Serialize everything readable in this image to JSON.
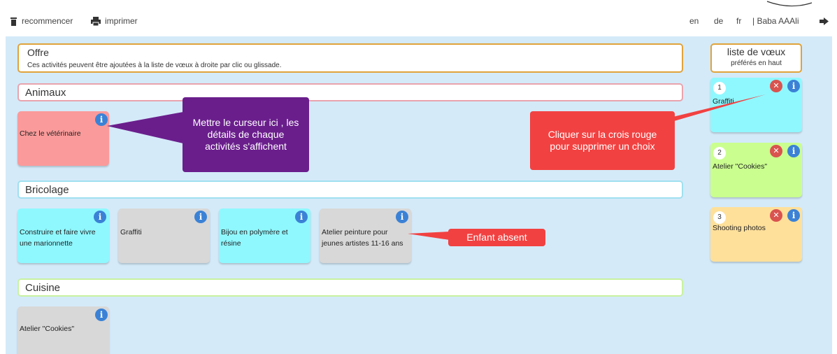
{
  "toolbar": {
    "restart_label": "recommencer",
    "print_label": "imprimer",
    "lang_en": "en",
    "lang_de": "de",
    "lang_fr": "fr",
    "user": "| Baba AAAli"
  },
  "offer": {
    "title": "Offre",
    "subtitle": "Ces activités peuvent être ajoutées à la liste de vœux à droite par clic ou glissade."
  },
  "categories": [
    {
      "title": "Animaux",
      "color": "#e9a3ad",
      "activities": [
        {
          "label": "Chez le vétérinaire",
          "color": "#fb9a9a"
        }
      ]
    },
    {
      "title": "Bricolage",
      "color": "#9fe0ef",
      "activities": [
        {
          "label": "Construire et faire vivre une marionnette",
          "color": "#8ff8ff"
        },
        {
          "label": "Graffiti",
          "color": "#d8d8d8"
        },
        {
          "label": "Bijou en polymère et résine",
          "color": "#8ff8ff"
        },
        {
          "label": "Atelier peinture pour jeunes artistes 11-16 ans",
          "color": "#d8d8d8"
        }
      ]
    },
    {
      "title": "Cuisine",
      "color": "#c8f2a0",
      "activities": [
        {
          "label": "Atelier \"Cookies\"",
          "color": "#d8d8d8"
        }
      ]
    }
  ],
  "wishlist": {
    "title": "liste de vœux",
    "subtitle": "préférés en haut",
    "items": [
      {
        "rank": "1",
        "label": "Graffiti",
        "color": "#8ff8ff"
      },
      {
        "rank": "2",
        "label": "Atelier \"Cookies\"",
        "color": "#caff8f"
      },
      {
        "rank": "3",
        "label": "Shooting photos",
        "color": "#ffe09a"
      }
    ]
  },
  "annotations": {
    "hover_tip": "Mettre le curseur ici , les détails de chaque activités s'affichent",
    "remove_tip": "Cliquer sur la crois rouge pour supprimer un choix",
    "absent_tip": "Enfant absent",
    "hover_color": "#6a1e8c",
    "red_color": "#f24141"
  },
  "icons": {
    "info": "info-icon",
    "remove": "remove-icon",
    "trash": "trash-icon",
    "print": "print-icon",
    "logout": "logout-icon"
  }
}
